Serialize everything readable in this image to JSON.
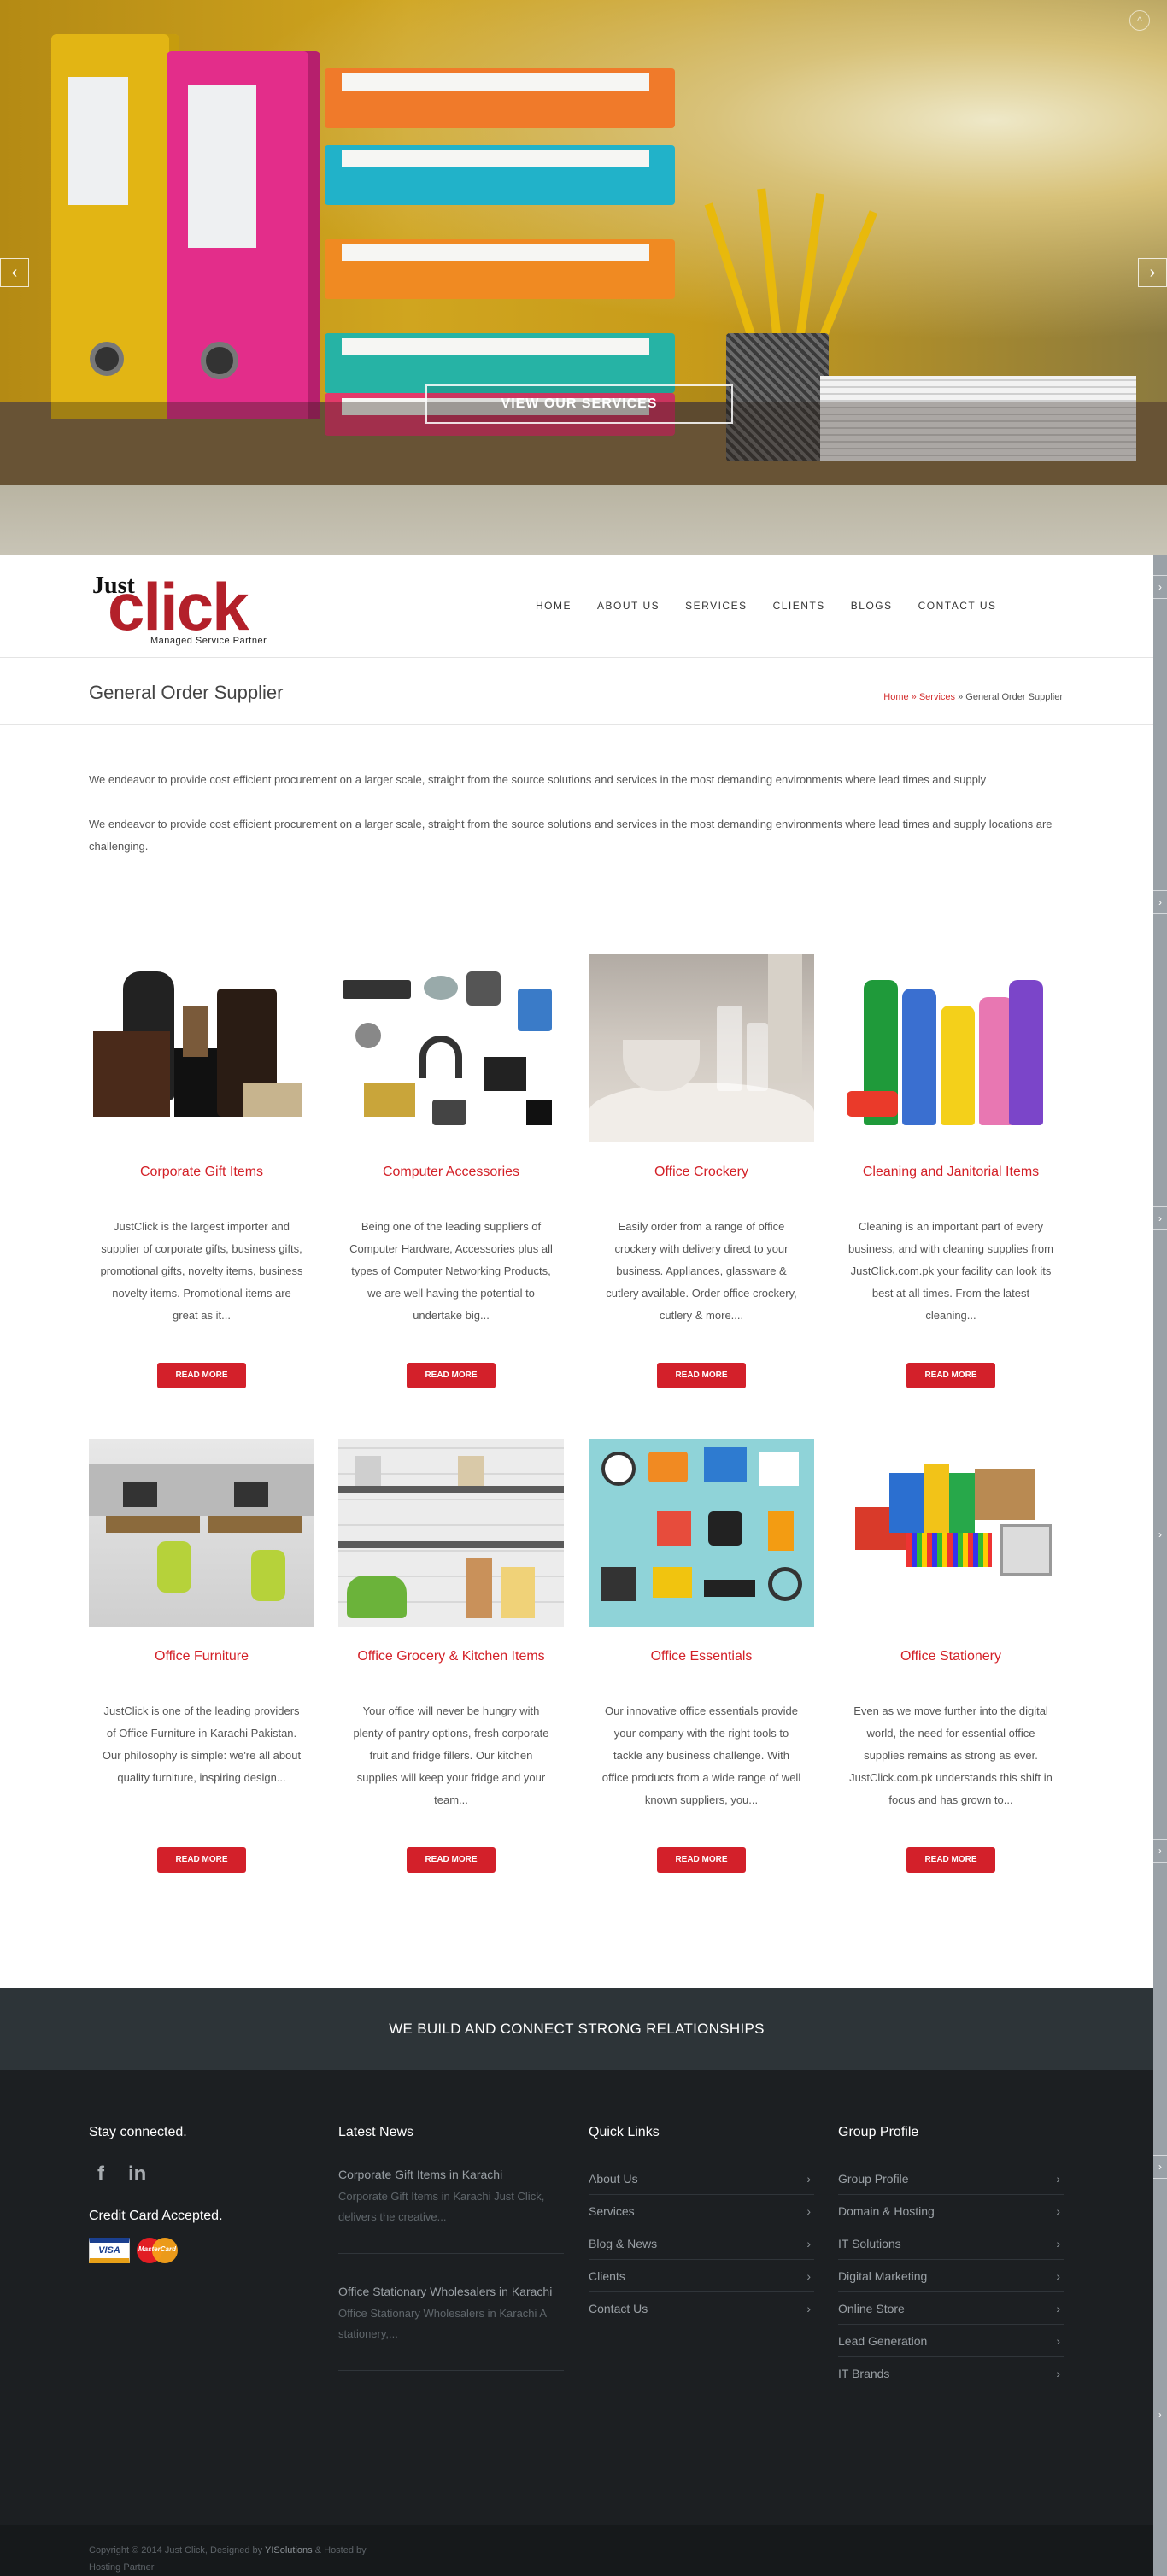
{
  "hero": {
    "button_label": "VIEW OUR SERVICES",
    "prev_icon": "chevron-left-icon",
    "next_icon": "chevron-right-icon",
    "prev_glyph": "‹",
    "next_glyph": "›",
    "scroll_top_glyph": "^"
  },
  "logo": {
    "just": "Just",
    "click": "click",
    "tagline": "Managed Service Partner"
  },
  "nav": {
    "items": [
      "HOME",
      "ABOUT US",
      "SERVICES",
      "CLIENTS",
      "BLOGS",
      "CONTACT US"
    ]
  },
  "page": {
    "title": "General Order Supplier",
    "breadcrumb": {
      "home": "Home",
      "sep1": " » ",
      "services": "Services",
      "sep2": " » ",
      "current": "General Order Supplier"
    }
  },
  "intro": {
    "p1": "We endeavor to provide cost efficient procurement on a larger scale, straight from the source solutions and services in the most demanding environments where lead times and supply",
    "p2": "We endeavor to provide cost efficient procurement on a larger scale, straight from the source solutions and services in the most demanding environments where lead times and supply locations are challenging."
  },
  "products": [
    {
      "title": "Corporate Gift Items",
      "desc": "JustClick is the largest importer and supplier of corporate gifts, business gifts, promotional gifts, novelty items, business novelty items. Promotional items are great as it...",
      "button": "READ MORE"
    },
    {
      "title": "Computer Accessories",
      "desc": "Being one of the leading suppliers of Computer Hardware, Accessories plus all types of Computer Networking Products, we are well having the potential to undertake big...",
      "button": "READ MORE"
    },
    {
      "title": "Office Crockery",
      "desc": "Easily order from a range of office crockery with delivery direct to your business. Appliances, glassware & cutlery available. Order office crockery, cutlery & more....",
      "button": "READ MORE"
    },
    {
      "title": "Cleaning and Janitorial Items",
      "desc": "Cleaning is an important part of every business, and with cleaning supplies from JustClick.com.pk your facility can look its best at all times. From the latest cleaning...",
      "button": "READ MORE"
    },
    {
      "title": "Office Furniture",
      "desc": "JustClick is one of the leading providers of Office Furniture in Karachi Pakistan.   Our philosophy is simple: we're all about quality furniture, inspiring design...",
      "button": "READ MORE"
    },
    {
      "title": "Office Grocery & Kitchen Items",
      "desc": "Your office will never be hungry with plenty of pantry options, fresh corporate fruit and fridge fillers.   Our kitchen supplies will keep your fridge and your team...",
      "button": "READ MORE"
    },
    {
      "title": "Office Essentials",
      "desc": "Our innovative office essentials provide your company with the right tools to tackle any business challenge. With office products from a wide range of well known suppliers, you...",
      "button": "READ MORE"
    },
    {
      "title": "Office Stationery",
      "desc": "Even as we move further into the digital world, the need for essential office supplies remains as strong as ever. JustClick.com.pk understands this shift in focus and has grown to...",
      "button": "READ MORE"
    }
  ],
  "banner": {
    "text": "WE BUILD AND CONNECT STRONG RELATIONSHIPS"
  },
  "footer": {
    "stay_connected": "Stay connected.",
    "social": [
      {
        "icon": "facebook-icon",
        "glyph": "f"
      },
      {
        "icon": "linkedin-icon",
        "glyph": "in"
      }
    ],
    "credit_title": "Credit Card Accepted.",
    "visa_label": "VISA",
    "mastercard_label": "MasterCard",
    "latest_news_title": "Latest News",
    "news": [
      {
        "title": "Corporate Gift Items in Karachi",
        "desc": "Corporate Gift Items in Karachi Just Click, delivers the creative..."
      },
      {
        "title": "Office Stationary Wholesalers in Karachi",
        "desc": "Office  Stationary  Wholesalers in Karachi A stationery,..."
      }
    ],
    "quick_links_title": "Quick Links",
    "quick_links": [
      "About Us",
      "Services",
      "Blog & News",
      "Clients",
      "Contact Us"
    ],
    "group_profile_title": "Group Profile",
    "group_links": [
      "Group Profile",
      "Domain & Hosting",
      "IT Solutions",
      "Digital Marketing",
      "Online Store",
      "Lead Generation",
      "IT Brands"
    ],
    "chevron_glyph": "›"
  },
  "copyright": {
    "prefix": "Copyright © 2014 Just Click, Designed by ",
    "designer": "YISolutions",
    "mid": " & Hosted by ",
    "host": "Hosting Partner"
  },
  "colors": {
    "accent_red": "#d3202a",
    "banner_bg": "#2d3438",
    "footer_bg": "#1c1f22"
  }
}
